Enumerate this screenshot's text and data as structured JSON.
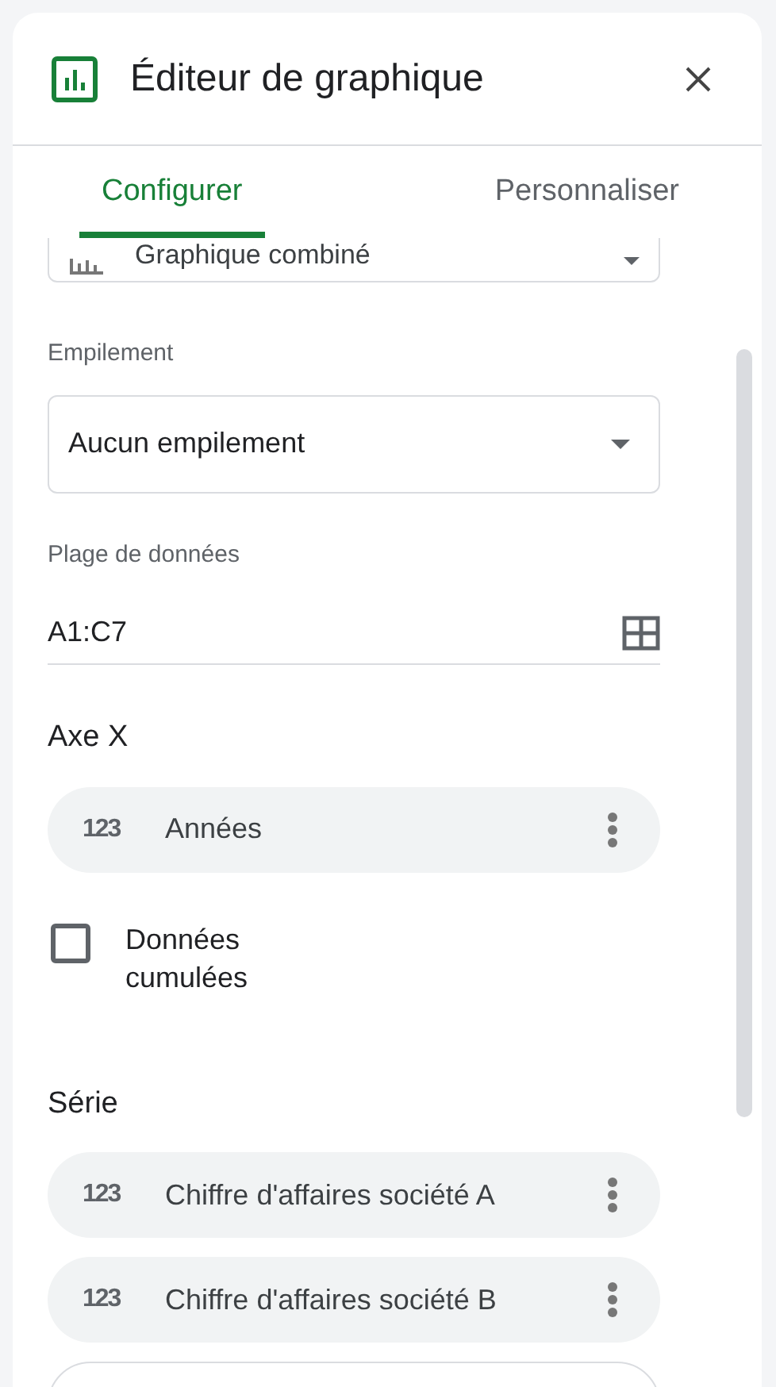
{
  "window": {
    "title": "Éditeur de graphique"
  },
  "tabs": [
    {
      "label": "Configurer",
      "selected": true
    },
    {
      "label": "Personnaliser",
      "selected": false
    }
  ],
  "chart_type": {
    "value": "Graphique combiné"
  },
  "stacking": {
    "label": "Empilement",
    "value": "Aucun empilement"
  },
  "data_range": {
    "label": "Plage de données",
    "value": "A1:C7"
  },
  "x_axis": {
    "heading": "Axe X",
    "items": [
      {
        "label": "Années",
        "type_badge": "123"
      }
    ]
  },
  "cumulative": {
    "label": "Données cumulées",
    "checked": false
  },
  "series": {
    "heading": "Série",
    "items": [
      {
        "label": "Chiffre d'affaires société A",
        "type_badge": "123"
      },
      {
        "label": "Chiffre d'affaires société B",
        "type_badge": "123"
      }
    ]
  }
}
